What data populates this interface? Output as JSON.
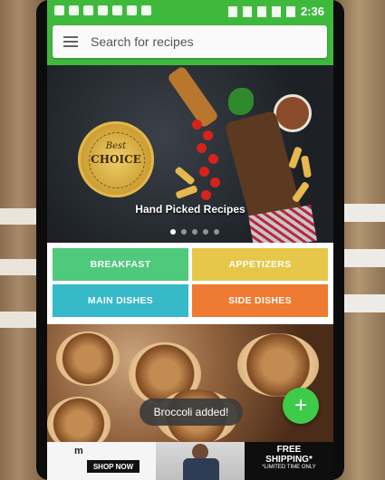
{
  "statusbar": {
    "time": "2:36"
  },
  "search": {
    "placeholder": "Search for recipes"
  },
  "hero": {
    "caption": "Hand Picked Recipes",
    "badge_top": "Best",
    "badge_word": "CHOICE"
  },
  "categories": [
    {
      "label": "BREAKFAST",
      "color": "#4fc97b"
    },
    {
      "label": "APPETIZERS",
      "color": "#e6c74a"
    },
    {
      "label": "MAIN DISHES",
      "color": "#36b9c9"
    },
    {
      "label": "SIDE DISHES",
      "color": "#ef7a32"
    }
  ],
  "toast": {
    "text": "Broccoli added!"
  },
  "fab": {
    "icon": "plus-icon",
    "glyph": "+"
  },
  "ad": {
    "brand": "m",
    "shop_label": "SHOP NOW",
    "ship_line1": "FREE",
    "ship_line2": "SHIPPING*",
    "ship_line3": "*LIMITED TIME ONLY"
  },
  "colors": {
    "accent": "#3fb93c",
    "fab": "#3fcb4a"
  }
}
